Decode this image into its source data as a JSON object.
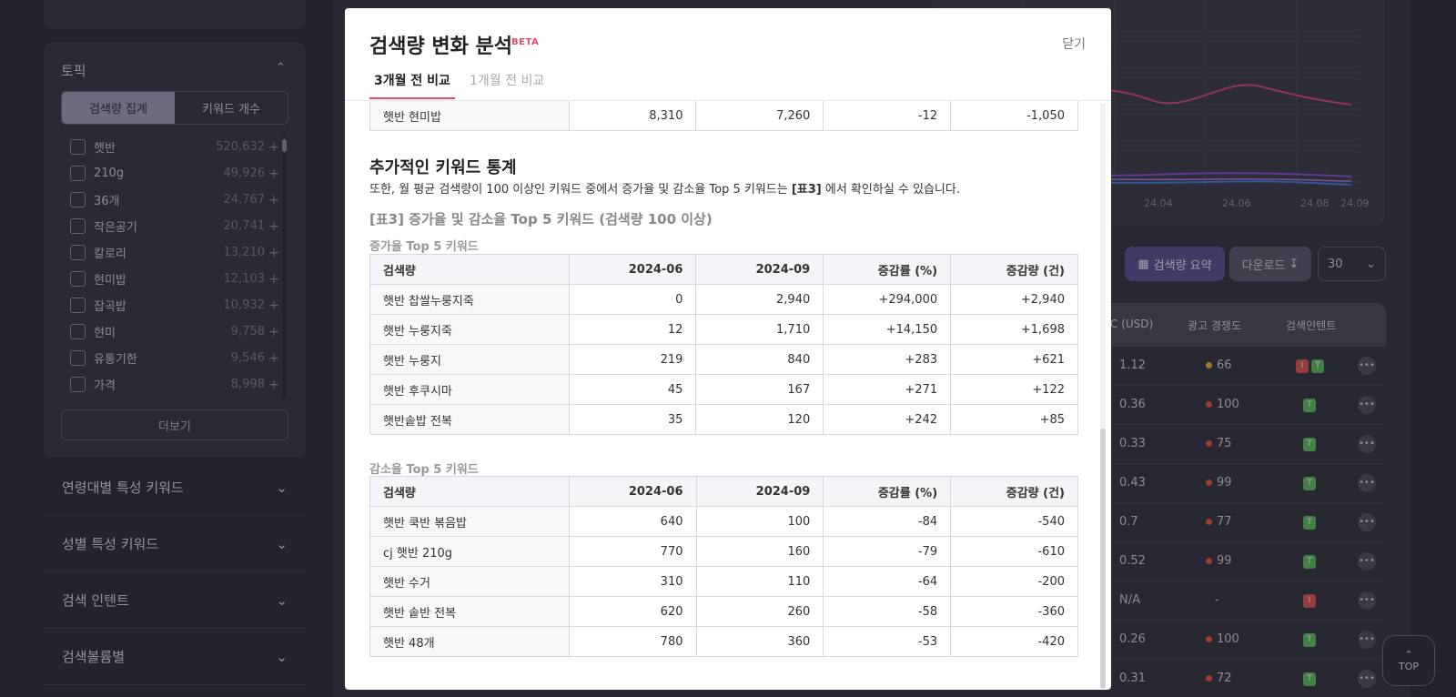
{
  "sidebar": {
    "topic": {
      "title": "토픽",
      "seg_volume": "검색량 집계",
      "seg_count": "키워드 개수",
      "keywords": [
        {
          "name": "햇반",
          "count": "520,632"
        },
        {
          "name": "210g",
          "count": "49,926"
        },
        {
          "name": "36개",
          "count": "24,767"
        },
        {
          "name": "작은공기",
          "count": "20,741"
        },
        {
          "name": "칼로리",
          "count": "13,210"
        },
        {
          "name": "현미밥",
          "count": "12,103"
        },
        {
          "name": "잡곡밥",
          "count": "10,932"
        },
        {
          "name": "현미",
          "count": "9,758"
        },
        {
          "name": "유통기한",
          "count": "9,546"
        },
        {
          "name": "가격",
          "count": "8,998"
        }
      ],
      "more_label": "더보기"
    },
    "accordions": [
      "연령대별 특성 키워드",
      "성별 특성 키워드",
      "검색 인텐트",
      "검색볼륨별"
    ]
  },
  "background": {
    "chart_ticks": [
      "24.04",
      "24.06",
      "24.08",
      "24.09"
    ],
    "summary_button": "검색량 요약",
    "download_button": "다운로드",
    "rows_select": "30",
    "headers": {
      "cpc": "C (USD)",
      "competition": "광고 경쟁도",
      "intent": "검색인텐트"
    },
    "rows": [
      {
        "cpc": "1.12",
        "comp": "66",
        "comp_color": "#e8b43a",
        "badges": [
          "I",
          "T"
        ]
      },
      {
        "cpc": "0.36",
        "comp": "100",
        "comp_color": "#e5533b",
        "badges": [
          "T"
        ]
      },
      {
        "cpc": "0.33",
        "comp": "75",
        "comp_color": "#e5533b",
        "badges": [
          "T"
        ]
      },
      {
        "cpc": "0.43",
        "comp": "99",
        "comp_color": "#e5533b",
        "badges": [
          "T"
        ]
      },
      {
        "cpc": "0.7",
        "comp": "77",
        "comp_color": "#e5533b",
        "badges": [
          "T"
        ]
      },
      {
        "cpc": "0.52",
        "comp": "99",
        "comp_color": "#e5533b",
        "badges": [
          "T"
        ]
      },
      {
        "cpc": "N/A",
        "comp": "-",
        "comp_color": "",
        "badges": [
          "I"
        ]
      },
      {
        "cpc": "0.26",
        "comp": "100",
        "comp_color": "#e5533b",
        "badges": [
          "T"
        ]
      },
      {
        "cpc": "0.31",
        "comp": "72",
        "comp_color": "#e5533b",
        "badges": [
          "T"
        ]
      }
    ],
    "top_button": "TOP"
  },
  "modal": {
    "title": "검색량 변화 분석",
    "beta": "BETA",
    "close": "닫기",
    "tabs": [
      "3개월 전 비교",
      "1개월 전 비교"
    ],
    "partial_row": [
      "햇반 현미밥",
      "8,310",
      "7,260",
      "-12",
      "-1,050"
    ],
    "section_title": "추가적인 키워드 통계",
    "section_desc_pre": "또한, 월 평균 검색량이 100 이상인 키워드 중에서 증가율 및 감소율 Top 5 키워드는 ",
    "section_desc_ref": "[표3]",
    "section_desc_post": " 에서 확인하실 수 있습니다.",
    "table_caption": "[표3] 증가율 및 감소율 Top 5 키워드 (검색량 100 이상)",
    "increase_caption": "증가율 Top 5 키워드",
    "decrease_caption": "감소율 Top 5 키워드",
    "columns": [
      "검색량",
      "2024-06",
      "2024-09",
      "증감률 (%)",
      "증감량 (건)"
    ],
    "increase_rows": [
      [
        "햇반 찹쌀누룽지죽",
        "0",
        "2,940",
        "+294,000",
        "+2,940"
      ],
      [
        "햇반 누룽지죽",
        "12",
        "1,710",
        "+14,150",
        "+1,698"
      ],
      [
        "햇반 누룽지",
        "219",
        "840",
        "+283",
        "+621"
      ],
      [
        "햇반 후쿠시마",
        "45",
        "167",
        "+271",
        "+122"
      ],
      [
        "햇반솥밥 전복",
        "35",
        "120",
        "+242",
        "+85"
      ]
    ],
    "decrease_rows": [
      [
        "햇반 쿡반 볶음밥",
        "640",
        "100",
        "-84",
        "-540"
      ],
      [
        "cj 햇반 210g",
        "770",
        "160",
        "-79",
        "-610"
      ],
      [
        "햇반 수거",
        "310",
        "110",
        "-64",
        "-200"
      ],
      [
        "햇반 솥반 전복",
        "620",
        "260",
        "-58",
        "-360"
      ],
      [
        "햇반 48개",
        "780",
        "360",
        "-53",
        "-420"
      ]
    ]
  },
  "colors": {
    "accent": "#e04b6b",
    "summary_button": "#5b4f8e"
  }
}
